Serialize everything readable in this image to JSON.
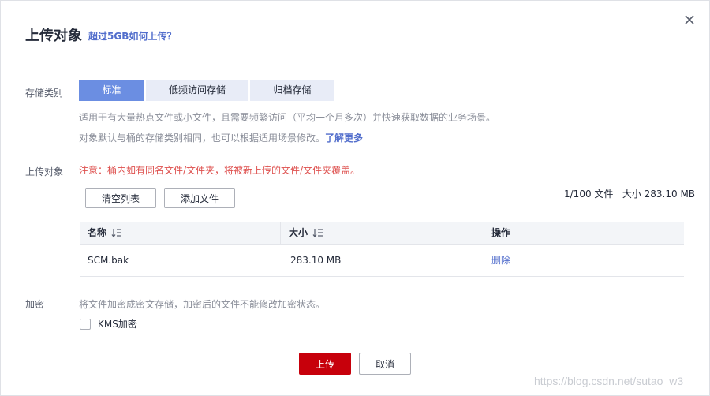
{
  "dialog": {
    "title": "上传对象",
    "title_link": "超过5GB如何上传？"
  },
  "storage": {
    "label": "存储类别",
    "options": [
      "标准",
      "低频访问存储",
      "归档存储"
    ],
    "selected": "标准",
    "desc1": "适用于有大量热点文件或小文件，且需要频繁访问（平均一个月多次）并快速获取数据的业务场景。",
    "desc2": "对象默认与桶的存储类别相同，也可以根据适用场景修改。",
    "learn_more": "了解更多"
  },
  "upload": {
    "label": "上传对象",
    "warning": "注意：桶内如有同名文件/文件夹，将被新上传的文件/文件夹覆盖。",
    "clear_button": "清空列表",
    "add_button": "添加文件",
    "stats": "1/100 文件   大小 283.10 MB"
  },
  "table": {
    "columns": [
      "名称",
      "大小",
      "操作"
    ],
    "rows": [
      {
        "name": "SCM.bak",
        "size": "283.10 MB",
        "action": "删除"
      }
    ]
  },
  "encryption": {
    "label": "加密",
    "desc": "将文件加密成密文存储，加密后的文件不能修改加密状态。",
    "kms_label": "KMS加密",
    "kms_checked": false
  },
  "footer": {
    "upload_button": "上传",
    "cancel_button": "取消"
  },
  "watermark": "https://blog.csdn.net/sutao_w3",
  "colors": {
    "accent": "#6b8ee2",
    "link": "#526ecc",
    "primary": "#c7000b",
    "warning": "#de504e"
  }
}
